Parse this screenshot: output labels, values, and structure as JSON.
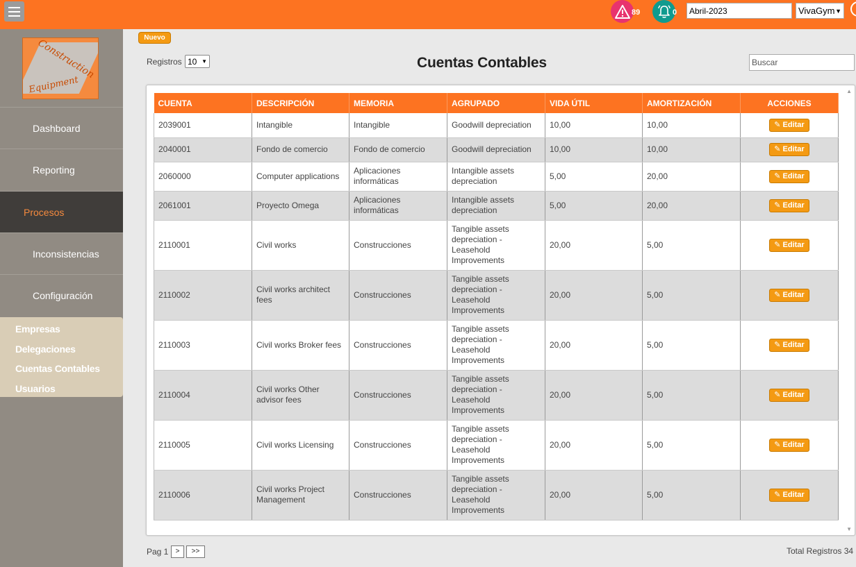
{
  "topbar": {
    "alerts_count": "89",
    "notifications_count": "0",
    "period_value": "Abril-2023",
    "company_selected": "VivaGym"
  },
  "sidebar": {
    "logo_line1": "Construction",
    "logo_line2": "Equipment",
    "items": [
      {
        "label": "Dashboard"
      },
      {
        "label": "Reporting"
      },
      {
        "label": "Procesos"
      },
      {
        "label": "Inconsistencias"
      },
      {
        "label": "Configuración"
      }
    ],
    "submenu": [
      {
        "label": "Empresas"
      },
      {
        "label": "Delegaciones"
      },
      {
        "label": "Cuentas Contables"
      },
      {
        "label": "Usuarios"
      }
    ]
  },
  "main": {
    "new_button": "Nuevo",
    "page_title": "Cuentas Contables",
    "registros_label": "Registros",
    "registros_value": "10",
    "search_placeholder": "Buscar",
    "columns": [
      "CUENTA",
      "DESCRIPCIÓN",
      "MEMORIA",
      "AGRUPADO",
      "VIDA ÚTIL",
      "AMORTIZACIÓN",
      "ACCIONES"
    ],
    "edit_label": "Editar",
    "rows": [
      {
        "cuenta": "2039001",
        "descripcion": "Intangible",
        "memoria": "Intangible",
        "agrupado": "Goodwill depreciation",
        "vida": "10,00",
        "amort": "10,00"
      },
      {
        "cuenta": "2040001",
        "descripcion": "Fondo de comercio",
        "memoria": "Fondo de comercio",
        "agrupado": "Goodwill depreciation",
        "vida": "10,00",
        "amort": "10,00"
      },
      {
        "cuenta": "2060000",
        "descripcion": "Computer applications",
        "memoria": "Aplicaciones informáticas",
        "agrupado": "Intangible assets depreciation",
        "vida": "5,00",
        "amort": "20,00"
      },
      {
        "cuenta": "2061001",
        "descripcion": "Proyecto Omega",
        "memoria": "Aplicaciones informáticas",
        "agrupado": "Intangible assets depreciation",
        "vida": "5,00",
        "amort": "20,00"
      },
      {
        "cuenta": "2110001",
        "descripcion": "Civil works",
        "memoria": "Construcciones",
        "agrupado": "Tangible assets depreciation - Leasehold Improvements",
        "vida": "20,00",
        "amort": "5,00"
      },
      {
        "cuenta": "2110002",
        "descripcion": "Civil works architect fees",
        "memoria": "Construcciones",
        "agrupado": "Tangible assets depreciation - Leasehold Improvements",
        "vida": "20,00",
        "amort": "5,00"
      },
      {
        "cuenta": "2110003",
        "descripcion": "Civil works Broker fees",
        "memoria": "Construcciones",
        "agrupado": "Tangible assets depreciation - Leasehold Improvements",
        "vida": "20,00",
        "amort": "5,00"
      },
      {
        "cuenta": "2110004",
        "descripcion": "Civil works Other advisor fees",
        "memoria": "Construcciones",
        "agrupado": "Tangible assets depreciation - Leasehold Improvements",
        "vida": "20,00",
        "amort": "5,00"
      },
      {
        "cuenta": "2110005",
        "descripcion": "Civil works Licensing",
        "memoria": "Construcciones",
        "agrupado": "Tangible assets depreciation - Leasehold Improvements",
        "vida": "20,00",
        "amort": "5,00"
      },
      {
        "cuenta": "2110006",
        "descripcion": "Civil works Project Management",
        "memoria": "Construcciones",
        "agrupado": "Tangible assets depreciation - Leasehold Improvements",
        "vida": "20,00",
        "amort": "5,00"
      }
    ]
  },
  "pagination": {
    "page_label": "Pag 1",
    "next": ">",
    "last": ">>",
    "total_label": "Total Registros 34"
  }
}
